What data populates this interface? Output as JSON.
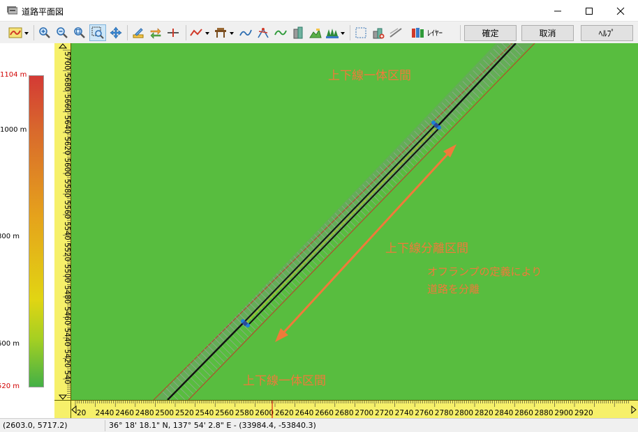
{
  "window": {
    "title": "道路平面図",
    "minimize_glyph": "—",
    "maximize_glyph": "☐",
    "close_glyph": "✕"
  },
  "toolbar": {
    "layer_label": "ﾚｲﾔｰ",
    "confirm_label": "確定",
    "cancel_label": "取消",
    "help_label": "ﾍﾙﾌﾟ",
    "icons": [
      "route-icon",
      "zoom-in-icon",
      "zoom-out-icon",
      "zoom-fit-icon",
      "zoom-window-icon",
      "pan-icon",
      "edit-icon",
      "convert-icon",
      "split-icon",
      "profile-icon",
      "structure-icon",
      "alignment-icon",
      "intersection-icon",
      "curve-icon",
      "building-icon",
      "terrain-icon",
      "trees-icon",
      "select-rect-icon",
      "add-point-icon",
      "line-icon",
      "layer-icon"
    ]
  },
  "elevation_scale": {
    "max_label": "1104 m",
    "labels": [
      {
        "text": "1104 m",
        "value": 1104,
        "red": true
      },
      {
        "text": "1000 m",
        "value": 1000,
        "red": false
      },
      {
        "text": "800 m",
        "value": 800,
        "red": false
      },
      {
        "text": "600 m",
        "value": 600,
        "red": false
      },
      {
        "text": "520 m",
        "value": 520,
        "red": true
      }
    ],
    "min": 520,
    "max": 1104
  },
  "rulers": {
    "vertical_labels": [
      "5700",
      "5680",
      "5660",
      "5640",
      "5620",
      "5600",
      "5580",
      "5560",
      "5540",
      "5520",
      "5500",
      "5480",
      "5460",
      "5440",
      "5420",
      "540"
    ],
    "horizontal_labels": [
      "20",
      "2440",
      "2460",
      "2480",
      "2500",
      "2520",
      "2540",
      "2560",
      "2580",
      "2600",
      "2620",
      "2640",
      "2660",
      "2680",
      "2700",
      "2720",
      "2740",
      "2760",
      "2780",
      "2800",
      "2820",
      "2840",
      "2860",
      "2880",
      "2900",
      "2920"
    ]
  },
  "map": {
    "label_top": "上下線一体区間",
    "label_middle": "上下線分離区間",
    "label_note_line1": "オフランプの定義により",
    "label_note_line2": "道路を分離",
    "label_bottom": "上下線一体区間",
    "background": "#58bd3f",
    "annotation_color": "#f07a3a"
  },
  "status": {
    "local_coords": "(2603.0, 5717.2)",
    "geo_coords": "36° 18' 18.1\" N, 137° 54' 2.8\" E  -  (33984.4, -53840.3)"
  }
}
